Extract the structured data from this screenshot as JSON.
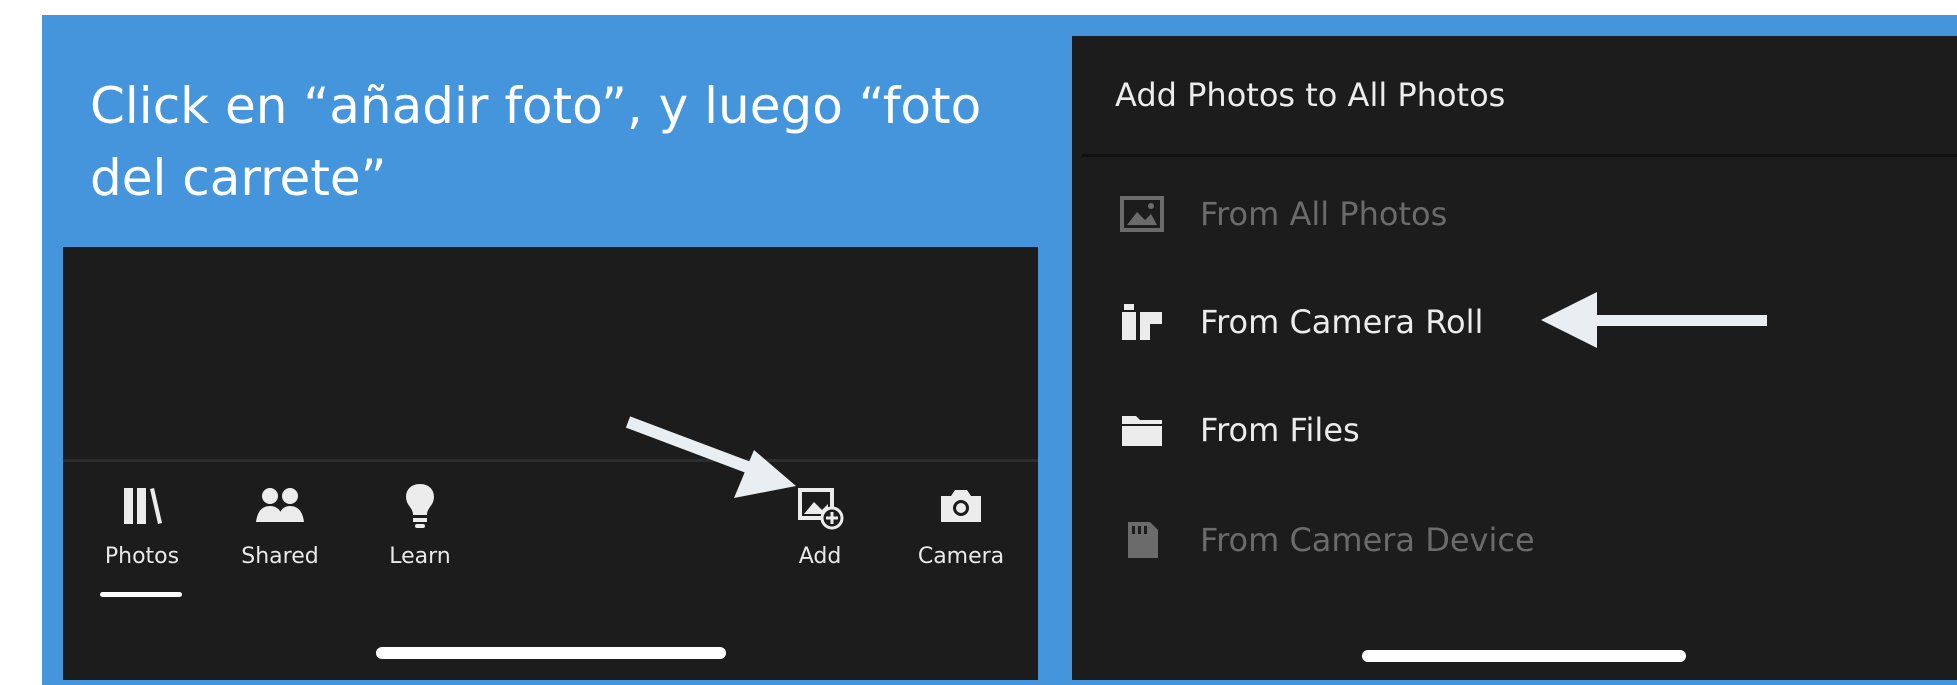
{
  "instruction": "Click en “añadir foto”, y luego “foto del carrete”",
  "left_panel": {
    "tabs": [
      {
        "label": "Photos",
        "icon": "library-icon"
      },
      {
        "label": "Shared",
        "icon": "people-icon"
      },
      {
        "label": "Learn",
        "icon": "lightbulb-icon"
      },
      {
        "label": "Add",
        "icon": "add-photo-icon"
      },
      {
        "label": "Camera",
        "icon": "camera-icon"
      }
    ],
    "active_tab": "Photos"
  },
  "right_panel": {
    "title": "Add Photos to All Photos",
    "items": [
      {
        "label": "From All Photos",
        "icon": "image-icon",
        "enabled": false
      },
      {
        "label": "From Camera Roll",
        "icon": "camera-roll-icon",
        "enabled": true
      },
      {
        "label": "From Files",
        "icon": "folder-icon",
        "enabled": true
      },
      {
        "label": "From Camera Device",
        "icon": "sd-card-icon",
        "enabled": false
      }
    ]
  },
  "colors": {
    "slide_background": "#4595dc",
    "panel_background": "#1c1c1c",
    "arrow": "#e8eef2",
    "text": "#ececec",
    "disabled_text": "#6b6b6b"
  }
}
